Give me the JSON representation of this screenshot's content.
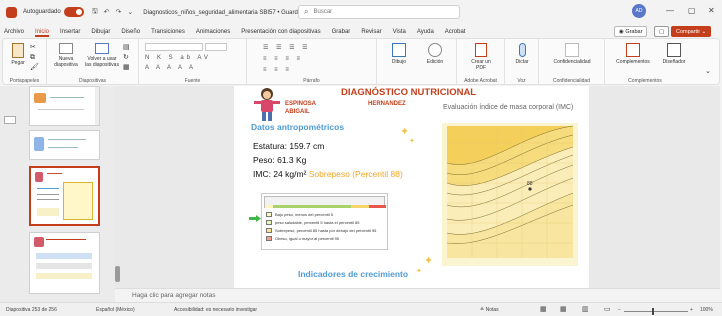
{
  "titlebar": {
    "autosave_label": "Autoguardado",
    "autosave_state": "●",
    "qa_save": "🖫",
    "qa_undo": "↶",
    "qa_redo": "↷",
    "qa_more": "⌄",
    "document_title": "Diagnosticos_niños_seguridad_alimentaria SBI57 • Guardado ⌄",
    "search_placeholder": "Buscar",
    "avatar_initials": "AD",
    "min_glyph": "—",
    "max_glyph": "▢",
    "close_glyph": "✕"
  },
  "menu": {
    "tabs": [
      "Archivo",
      "Inicio",
      "Insertar",
      "Dibujar",
      "Diseño",
      "Transiciones",
      "Animaciones",
      "Presentación con diapositivas",
      "Grabar",
      "Revisar",
      "Vista",
      "Ayuda",
      "Acrobat"
    ],
    "record_button": "◉ Grabar",
    "comment_button": "▢",
    "share_button": "Compartir ⌄"
  },
  "ribbon": {
    "groups": [
      {
        "name": "clipboard",
        "label": "Portapapeles",
        "buttons": [
          "Pegar"
        ]
      },
      {
        "name": "slides",
        "label": "Diapositivas",
        "buttons": [
          "Nueva diapositiva",
          "Volver a usar las diapositivas"
        ]
      },
      {
        "name": "font",
        "label": "Fuente",
        "buttons": []
      },
      {
        "name": "paragraph",
        "label": "Párrafo",
        "buttons": []
      },
      {
        "name": "drawing",
        "label": "",
        "buttons": [
          "Dibujo",
          "Edición"
        ]
      },
      {
        "name": "acrobat",
        "label": "Adobe Acrobat",
        "buttons": [
          "Crear un PDF"
        ]
      },
      {
        "name": "voice",
        "label": "Voz",
        "buttons": [
          "Dictar"
        ]
      },
      {
        "name": "confidentiality",
        "label": "Confidencialidad",
        "buttons": [
          "Confidencialidad"
        ]
      },
      {
        "name": "addins",
        "label": "Complementos",
        "buttons": [
          "Complementos",
          "Diseñador"
        ]
      }
    ],
    "format_row1": "N K S ab AV",
    "format_row2": "A A A A A",
    "para_row1": "☰ ☰ ☰ ☰",
    "para_row2": "≡ ≡ ≡ ≡",
    "clipboard_launcher": "⌄"
  },
  "thumbnails": [
    {
      "number": "",
      "selected": false
    },
    {
      "number": "",
      "selected": false
    },
    {
      "number": "",
      "selected": true
    },
    {
      "number": "",
      "selected": false
    }
  ],
  "slide": {
    "title": "DIAGNÓSTICO NUTRICIONAL",
    "name_first": "ESPINOSA",
    "name_last": "HERNANDEZ",
    "name_given": "ABIGAIL",
    "section_title": "Datos antropométricos",
    "height_label": "Estatura: 159.7 cm",
    "weight_label": "Peso: 61.3 Kg",
    "bmi_label": "IMC: 24 kg/m²",
    "bmi_status": "Sobrepeso (Percentil 88)",
    "chart_title": "Evaluación índice de masa corporal (IMC)",
    "growth_title": "Indicadores de crecimiento",
    "legend_items": [
      {
        "color": "#fff6c4",
        "label": "Bajo peso, menos del percentil 5"
      },
      {
        "color": "#e8f3b8",
        "label": "peso saludable, percentil 5 hasta el percentil 85"
      },
      {
        "color": "#fbe39a",
        "label": "Sobrepeso, percentil 85 hasta por debajo del percentil 95"
      },
      {
        "color": "#f4a08a",
        "label": "Obeso, igual o mayor al percentil 95"
      }
    ],
    "chart_point_label": "88"
  },
  "notes": {
    "placeholder": "Haga clic para agregar notas"
  },
  "status": {
    "slide_count": "Diapositiva 253 de 256",
    "language": "Español (México)",
    "accessibility": "Accesibilidad: es necesario investigar",
    "notes_btn": "≜ Notas",
    "zoom": "100%"
  },
  "colors": {
    "accent": "#c43e1c",
    "section_blue": "#4f9bd8",
    "overweight": "#f5a623",
    "chart_band": "#f6d56b"
  }
}
